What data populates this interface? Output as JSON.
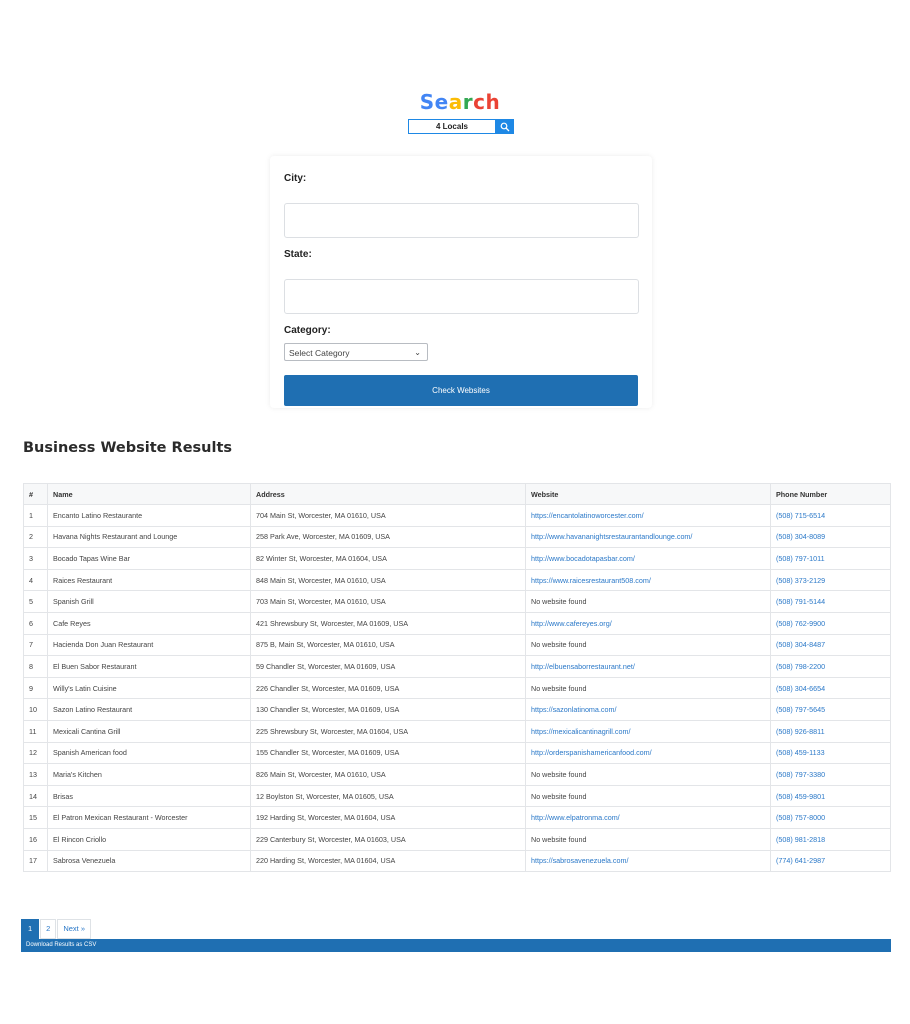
{
  "logo": {
    "letters": [
      {
        "char": "S",
        "color": "#4285F4"
      },
      {
        "char": "e",
        "color": "#4285F4"
      },
      {
        "char": "a",
        "color": "#FBBC05"
      },
      {
        "char": "r",
        "color": "#34A853"
      },
      {
        "char": "c",
        "color": "#EA4335"
      },
      {
        "char": "h",
        "color": "#EA4335"
      }
    ],
    "search_text": "4 Locals",
    "search_icon": "search-icon"
  },
  "form": {
    "city_label": "City:",
    "city_value": "",
    "state_label": "State:",
    "state_value": "",
    "category_label": "Category:",
    "category_selected": "Select Category",
    "submit_label": "Check Websites"
  },
  "results": {
    "title": "Business Website Results",
    "columns": [
      "#",
      "Name",
      "Address",
      "Website",
      "Phone Number"
    ],
    "rows": [
      {
        "num": "1",
        "name": "Encanto Latino Restaurante",
        "address": "704 Main St, Worcester, MA 01610, USA",
        "website": "https://encantolatinoworcester.com/",
        "phone": "(508) 715-6514"
      },
      {
        "num": "2",
        "name": "Havana Nights Restaurant and Lounge",
        "address": "258 Park Ave, Worcester, MA 01609, USA",
        "website": "http://www.havananightsrestaurantandlounge.com/",
        "phone": "(508) 304-8089"
      },
      {
        "num": "3",
        "name": "Bocado Tapas Wine Bar",
        "address": "82 Winter St, Worcester, MA 01604, USA",
        "website": "http://www.bocadotapasbar.com/",
        "phone": "(508) 797-1011"
      },
      {
        "num": "4",
        "name": "Raices Restaurant",
        "address": "848 Main St, Worcester, MA 01610, USA",
        "website": "https://www.raicesrestaurant508.com/",
        "phone": "(508) 373-2129"
      },
      {
        "num": "5",
        "name": "Spanish Grill",
        "address": "703 Main St, Worcester, MA 01610, USA",
        "website": "No website found",
        "phone": "(508) 791-5144"
      },
      {
        "num": "6",
        "name": "Cafe Reyes",
        "address": "421 Shrewsbury St, Worcester, MA 01609, USA",
        "website": "http://www.cafereyes.org/",
        "phone": "(508) 762-9900"
      },
      {
        "num": "7",
        "name": "Hacienda Don Juan Restaurant",
        "address": "875 B, Main St, Worcester, MA 01610, USA",
        "website": "No website found",
        "phone": "(508) 304-8487"
      },
      {
        "num": "8",
        "name": "El Buen Sabor Restaurant",
        "address": "59 Chandler St, Worcester, MA 01609, USA",
        "website": "http://elbuensaborrestaurant.net/",
        "phone": "(508) 798-2200"
      },
      {
        "num": "9",
        "name": "Willy's Latin Cuisine",
        "address": "226 Chandler St, Worcester, MA 01609, USA",
        "website": "No website found",
        "phone": "(508) 304-6654"
      },
      {
        "num": "10",
        "name": "Sazon Latino Restaurant",
        "address": "130 Chandler St, Worcester, MA 01609, USA",
        "website": "https://sazonlatinoma.com/",
        "phone": "(508) 797-5645"
      },
      {
        "num": "11",
        "name": "Mexicali Cantina Grill",
        "address": "225 Shrewsbury St, Worcester, MA 01604, USA",
        "website": "https://mexicalicantinagrill.com/",
        "phone": "(508) 926-8811"
      },
      {
        "num": "12",
        "name": "Spanish American food",
        "address": "155 Chandler St, Worcester, MA 01609, USA",
        "website": "http://orderspanishamericanfood.com/",
        "phone": "(508) 459-1133"
      },
      {
        "num": "13",
        "name": "Maria's Kitchen",
        "address": "826 Main St, Worcester, MA 01610, USA",
        "website": "No website found",
        "phone": "(508) 797-3380"
      },
      {
        "num": "14",
        "name": "Brisas",
        "address": "12 Boylston St, Worcester, MA 01605, USA",
        "website": "No website found",
        "phone": "(508) 459-9801"
      },
      {
        "num": "15",
        "name": "El Patron Mexican Restaurant - Worcester",
        "address": "192 Harding St, Worcester, MA 01604, USA",
        "website": "http://www.elpatronma.com/",
        "phone": "(508) 757-8000"
      },
      {
        "num": "16",
        "name": "El Rincon Criollo",
        "address": "229 Canterbury St, Worcester, MA 01603, USA",
        "website": "No website found",
        "phone": "(508) 981-2818"
      },
      {
        "num": "17",
        "name": "Sabrosa Venezuela",
        "address": "220 Harding St, Worcester, MA 01604, USA",
        "website": "https://sabrosavenezuela.com/",
        "phone": "(774) 641-2987"
      }
    ]
  },
  "pagination": {
    "pages": [
      "1",
      "2"
    ],
    "active": "1",
    "next_label": "Next »"
  },
  "download_label": "Download Results as CSV",
  "colors": {
    "primary": "#1f6fb2",
    "link": "#2a78c8",
    "logo_search_accent": "#1e88e5"
  }
}
